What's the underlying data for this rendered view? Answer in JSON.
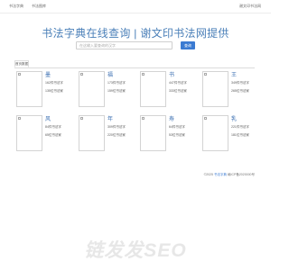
{
  "topnav": {
    "links": [
      "书法字典",
      "书法图库"
    ],
    "right_link": "谢文印书法网"
  },
  "header": {
    "title": "书法字典在线查询 | 谢文印书法网提供"
  },
  "search": {
    "placeholder": "在这输入要查询的汉字",
    "button_label": "查询"
  },
  "tabs": [
    {
      "label": "首页数据"
    }
  ],
  "characters": [
    {
      "char": "墨",
      "line1": "162件书法字",
      "line2": "135位书法家"
    },
    {
      "char": "福",
      "line1": "173件书法字",
      "line2": "159位书法家"
    },
    {
      "char": "书",
      "line1": "447件书法字",
      "line2": "333位书法家"
    },
    {
      "char": "王",
      "line1": "349件书法字",
      "line2": "265位书法家"
    },
    {
      "char": "风",
      "line1": "84件书法字",
      "line2": "65位书法家"
    },
    {
      "char": "年",
      "line1": "309件书法字",
      "line2": "220位书法家"
    },
    {
      "char": "寿",
      "line1": "64件书法字",
      "line2": "53位书法家"
    },
    {
      "char": "乳",
      "line1": "221件书法字",
      "line2": "181位书法家"
    }
  ],
  "footer": {
    "copyright": "©2025",
    "site_link": "书法字典",
    "icp": "赣ICP备2020000号"
  },
  "watermark": {
    "text": "链发发SEO"
  }
}
